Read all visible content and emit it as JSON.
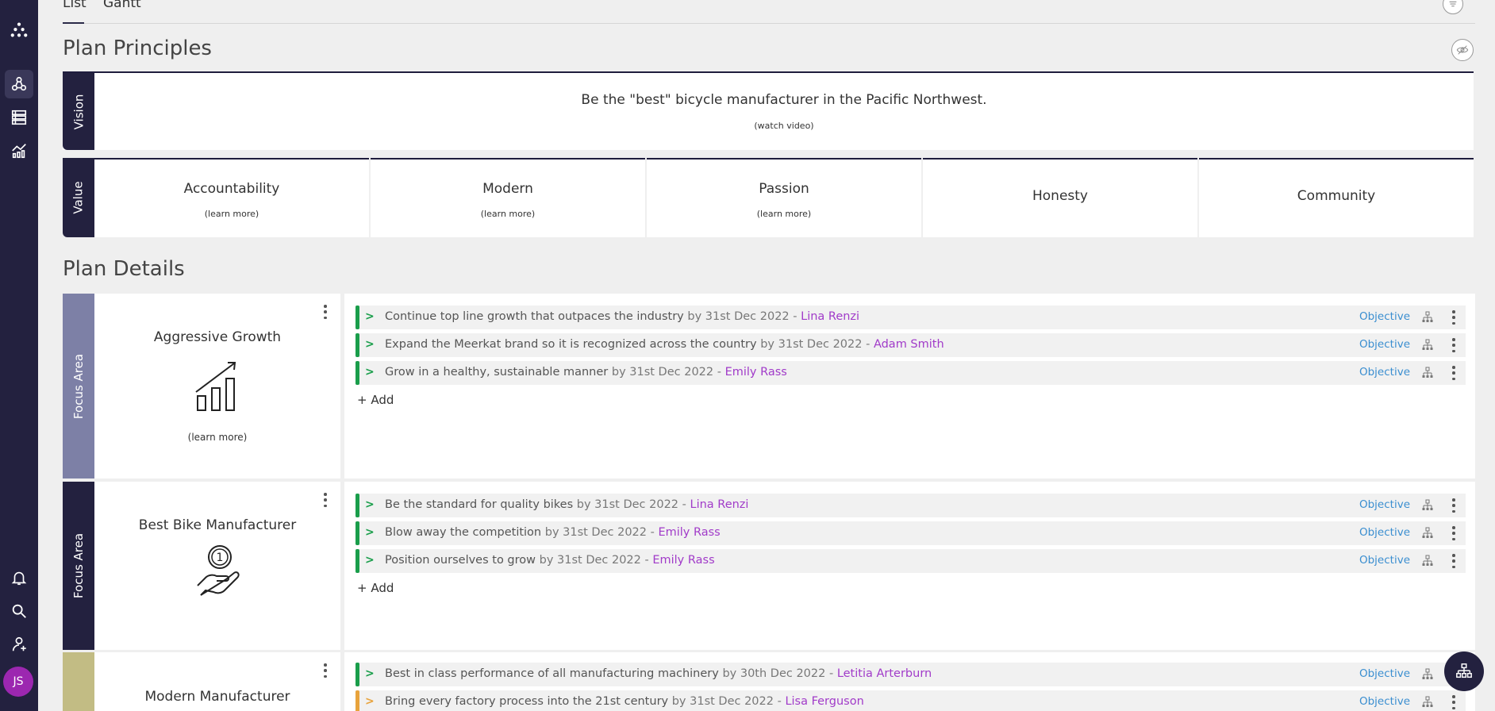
{
  "tabs": [
    {
      "label": "List"
    },
    {
      "label": "Gantt"
    }
  ],
  "principles": {
    "heading": "Plan Principles",
    "vision": {
      "label": "Vision",
      "text": "Be the \"best\" bicycle manufacturer in the Pacific Northwest.",
      "link": "(watch video)"
    },
    "value_label": "Value",
    "values": [
      {
        "title": "Accountability",
        "link": "(learn more)"
      },
      {
        "title": "Modern",
        "link": "(learn more)"
      },
      {
        "title": "Passion",
        "link": "(learn more)"
      },
      {
        "title": "Honesty"
      },
      {
        "title": "Community"
      }
    ]
  },
  "details": {
    "heading": "Plan Details",
    "focus_areas": [
      {
        "label": "Focus Area",
        "title": "Aggressive Growth",
        "link": "(learn more)",
        "label_color": "#7d80a6",
        "objectives": [
          {
            "text": "Continue top line growth that outpaces the industry",
            "date": "by 31st Dec 2022 -",
            "owner": "Lina Renzi",
            "type": "Objective"
          },
          {
            "text": "Expand the Meerkat brand so it is recognized across the country",
            "date": "by 31st Dec 2022 -",
            "owner": "Adam Smith",
            "type": "Objective"
          },
          {
            "text": "Grow in a healthy, sustainable manner",
            "date": "by 31st Dec 2022 -",
            "owner": "Emily Rass",
            "type": "Objective"
          }
        ],
        "add_label": "+ Add"
      },
      {
        "label": "Focus Area",
        "title": "Best Bike Manufacturer",
        "label_color": "#23213f",
        "objectives": [
          {
            "text": "Be the standard for quality bikes",
            "date": "by 31st Dec 2022 -",
            "owner": "Lina Renzi",
            "type": "Objective"
          },
          {
            "text": "Blow away the competition",
            "date": "by 31st Dec 2022 -",
            "owner": "Emily Rass",
            "type": "Objective"
          },
          {
            "text": "Position ourselves to grow",
            "date": "by 31st Dec 2022 -",
            "owner": "Emily Rass",
            "type": "Objective"
          }
        ],
        "add_label": "+ Add"
      },
      {
        "label": "",
        "title": "Modern Manufacturer",
        "label_color": "#c2bc84",
        "objectives": [
          {
            "text": "Best in class performance of all manufacturing machinery",
            "date": "by 30th Dec 2022 -",
            "owner": "Letitia Arterburn",
            "type": "Objective",
            "status_color": "#1a9e4b"
          },
          {
            "text": "Bring every factory process into the 21st century",
            "date": "by 31st Dec 2022 -",
            "owner": "Lisa Ferguson",
            "type": "Objective",
            "status_color": "#e8a33c"
          }
        ]
      }
    ]
  },
  "user": {
    "initials": "JS"
  },
  "colors": {
    "sidebar": "#23213f",
    "accent_purple": "#a13bc9",
    "link_blue": "#3a8ed0",
    "status_green": "#1a9e4b",
    "status_orange": "#e8a33c"
  }
}
